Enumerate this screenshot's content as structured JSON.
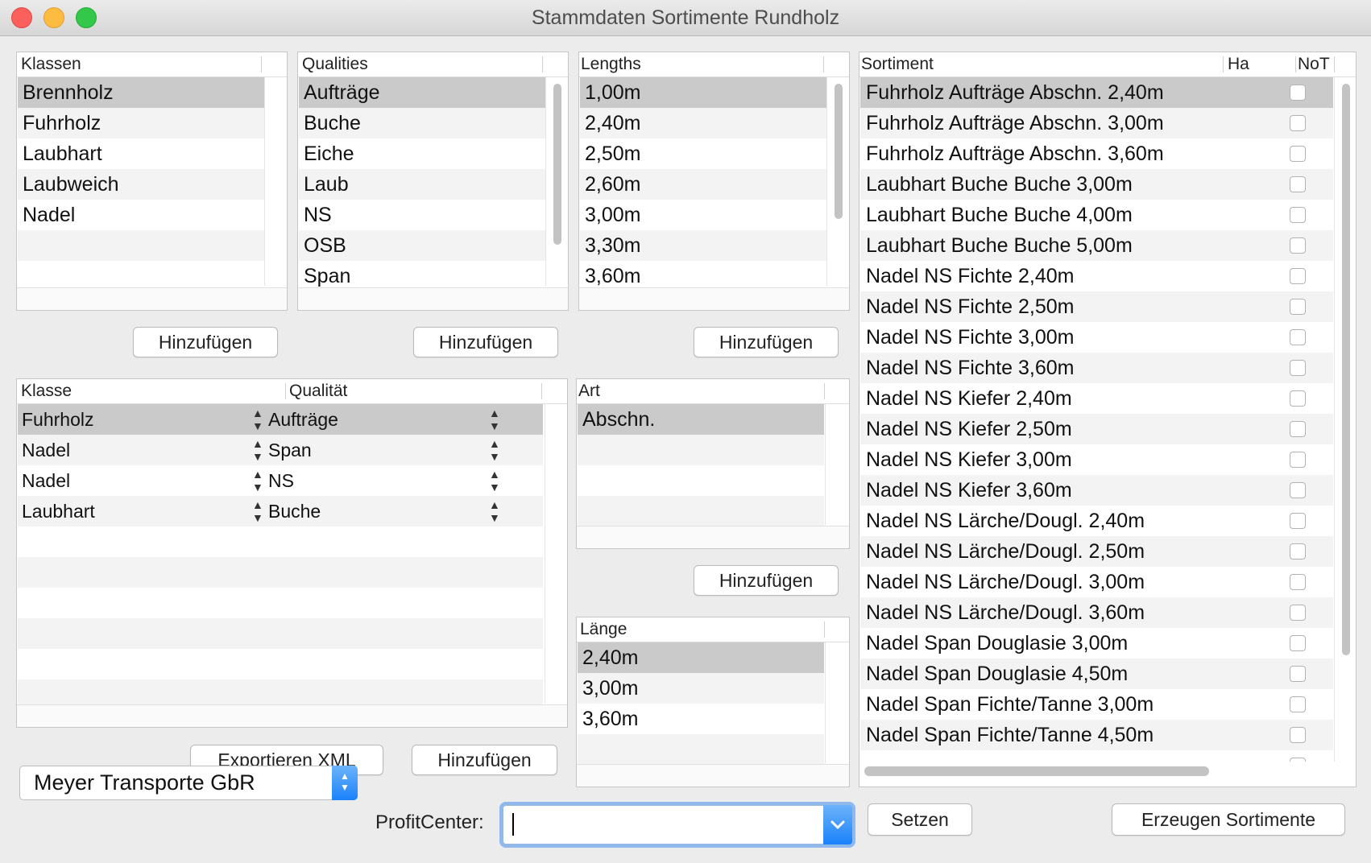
{
  "window": {
    "title": "Stammdaten Sortimente Rundholz"
  },
  "klassen": {
    "header": "Klassen",
    "items": [
      "Brennholz",
      "Fuhrholz",
      "Laubhart",
      "Laubweich",
      "Nadel",
      "",
      ""
    ]
  },
  "qualities": {
    "header": "Qualities",
    "items": [
      "Aufträge",
      "Buche",
      "Eiche",
      "Laub",
      "NS",
      "OSB",
      "Span"
    ]
  },
  "lengths": {
    "header": "Lengths",
    "items": [
      "1,00m",
      "2,40m",
      "2,50m",
      "2,60m",
      "3,00m",
      "3,30m",
      "3,60m"
    ]
  },
  "add_label": "Hinzufügen",
  "mapping": {
    "header_klasse": "Klasse",
    "header_qualitaet": "Qualität",
    "rows": [
      {
        "klasse": "Fuhrholz",
        "qualitaet": "Aufträge"
      },
      {
        "klasse": "Nadel",
        "qualitaet": "Span"
      },
      {
        "klasse": "Nadel",
        "qualitaet": "NS"
      },
      {
        "klasse": "Laubhart",
        "qualitaet": "Buche"
      }
    ]
  },
  "art": {
    "header": "Art",
    "items": [
      "Abschn."
    ]
  },
  "laenge": {
    "header": "Länge",
    "items": [
      "2,40m",
      "3,00m",
      "3,60m"
    ]
  },
  "sortiment": {
    "header": "Sortiment",
    "col_ha": "Ha",
    "col_not": "NoT",
    "items": [
      "Fuhrholz Aufträge Abschn. 2,40m",
      "Fuhrholz Aufträge Abschn. 3,00m",
      "Fuhrholz Aufträge Abschn. 3,60m",
      "Laubhart Buche Buche 3,00m",
      "Laubhart Buche Buche 4,00m",
      "Laubhart Buche Buche 5,00m",
      "Nadel NS Fichte 2,40m",
      "Nadel NS Fichte 2,50m",
      "Nadel NS Fichte 3,00m",
      "Nadel NS Fichte 3,60m",
      "Nadel NS Kiefer 2,40m",
      "Nadel NS Kiefer 2,50m",
      "Nadel NS Kiefer 3,00m",
      "Nadel NS Kiefer 3,60m",
      "Nadel NS Lärche/Dougl. 2,40m",
      "Nadel NS Lärche/Dougl. 2,50m",
      "Nadel NS Lärche/Dougl. 3,00m",
      "Nadel NS Lärche/Dougl. 3,60m",
      "Nadel Span Douglasie 3,00m",
      "Nadel Span Douglasie 4,50m",
      "Nadel Span Fichte/Tanne 3,00m",
      "Nadel Span Fichte/Tanne 4,50m"
    ]
  },
  "buttons": {
    "export_xml": "Exportieren XML",
    "setzen": "Setzen",
    "erzeugen": "Erzeugen Sortimente"
  },
  "company_select": {
    "value": "Meyer Transporte GbR"
  },
  "profit_center": {
    "label": "ProfitCenter:",
    "value": ""
  },
  "colors": {
    "selection": "#cacaca",
    "accent": "#1a82fb",
    "focus_ring": "#8fb8ec"
  }
}
